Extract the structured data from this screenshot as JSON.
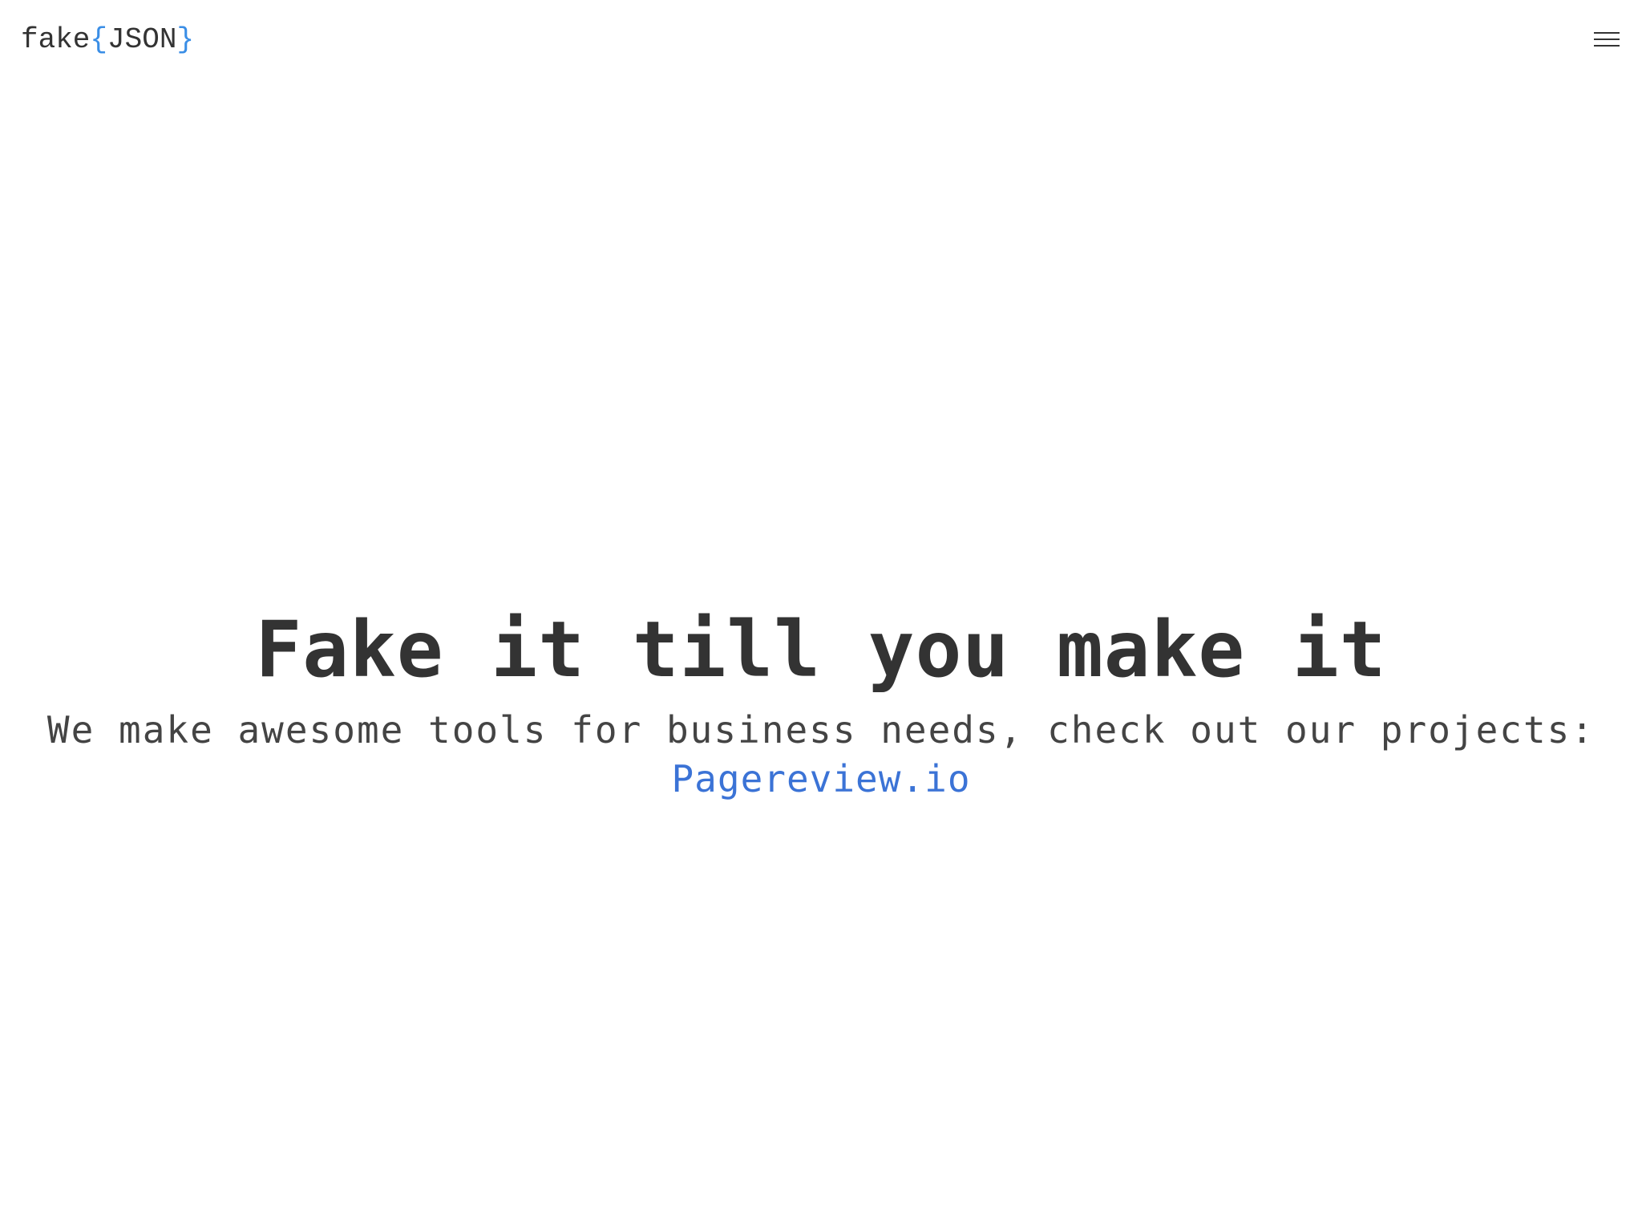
{
  "header": {
    "logo": {
      "prefix": "fake",
      "open_brace": "{",
      "name": "JSON",
      "close_brace": "}"
    },
    "menu_icon": "hamburger-menu-icon"
  },
  "hero": {
    "title": "Fake it till you make it",
    "subtitle": "We make awesome tools for business needs, check out our projects:",
    "link_label": "Pagereview.io"
  },
  "colors": {
    "text": "#333333",
    "brace_accent": "#3a8ee6",
    "link": "#3b73d6",
    "background": "#ffffff"
  }
}
